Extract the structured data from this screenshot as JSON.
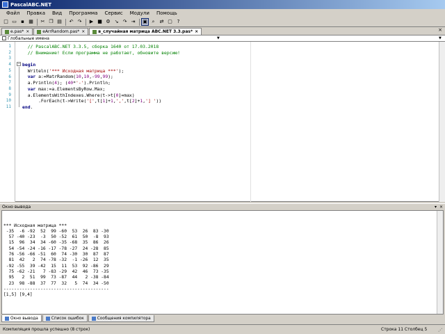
{
  "window": {
    "title": "PascalABC.NET"
  },
  "menu": [
    "Файл",
    "Правка",
    "Вид",
    "Программа",
    "Сервис",
    "Модули",
    "Помощь"
  ],
  "toolbar": {
    "buttons": [
      "new",
      "open",
      "save",
      "save-all",
      "cut",
      "copy",
      "paste",
      "undo",
      "redo",
      "run",
      "stop",
      "compile",
      "step-into",
      "step-over",
      "run-to-cursor",
      "toggle-output",
      "find",
      "replace",
      "form",
      "help"
    ],
    "active_index": 15
  },
  "tabs": [
    {
      "label": "e.pas*",
      "active": false
    },
    {
      "label": "eArrRandom.pas*",
      "active": false
    },
    {
      "label": "в_случайная матрица ABC.NET 3.3.pas*",
      "active": true
    }
  ],
  "navbar": {
    "scope": "Глобальные имена"
  },
  "editor": {
    "lines": [
      {
        "n": "1",
        "segments": [
          {
            "t": "  // PascalABC.NET 3.3.5, сборка 1640 от 17.03.2018",
            "c": "comment"
          }
        ]
      },
      {
        "n": "2",
        "segments": [
          {
            "t": "  // Внимание! Если программа не работает, обновите версию!",
            "c": "comment"
          }
        ]
      },
      {
        "n": "3",
        "segments": []
      },
      {
        "n": "4",
        "segments": [
          {
            "t": "begin",
            "c": "kw"
          }
        ]
      },
      {
        "n": "5",
        "segments": [
          {
            "t": "  Writeln(",
            "c": ""
          },
          {
            "t": "'*** Исходная матрица ***'",
            "c": "str"
          },
          {
            "t": ");",
            "c": ""
          }
        ]
      },
      {
        "n": "6",
        "segments": [
          {
            "t": "  ",
            "c": ""
          },
          {
            "t": "var",
            "c": "kw"
          },
          {
            "t": " a:=MatrRandom(",
            "c": ""
          },
          {
            "t": "10",
            "c": "num"
          },
          {
            "t": ",",
            "c": ""
          },
          {
            "t": "10",
            "c": "num"
          },
          {
            "t": ",-",
            "c": ""
          },
          {
            "t": "99",
            "c": "num"
          },
          {
            "t": ",",
            "c": ""
          },
          {
            "t": "99",
            "c": "num"
          },
          {
            "t": ");",
            "c": ""
          }
        ]
      },
      {
        "n": "7",
        "segments": [
          {
            "t": "  a.Println(",
            "c": ""
          },
          {
            "t": "4",
            "c": "num"
          },
          {
            "t": "); (",
            "c": ""
          },
          {
            "t": "40",
            "c": "num"
          },
          {
            "t": "*",
            "c": ""
          },
          {
            "t": "'-'",
            "c": "str"
          },
          {
            "t": ").Println;",
            "c": ""
          }
        ]
      },
      {
        "n": "8",
        "segments": [
          {
            "t": "  ",
            "c": ""
          },
          {
            "t": "var",
            "c": "kw"
          },
          {
            "t": " max:=a.ElementsByRow.Max;",
            "c": ""
          }
        ]
      },
      {
        "n": "9",
        "segments": [
          {
            "t": "  a.ElementsWithIndexes.Where(t->t[",
            "c": ""
          },
          {
            "t": "0",
            "c": "num"
          },
          {
            "t": "]=max)",
            "c": ""
          }
        ]
      },
      {
        "n": "10",
        "segments": [
          {
            "t": "      .ForEach(t->Write(",
            "c": ""
          },
          {
            "t": "'['",
            "c": "str"
          },
          {
            "t": ",t[",
            "c": ""
          },
          {
            "t": "1",
            "c": "num"
          },
          {
            "t": "]+",
            "c": ""
          },
          {
            "t": "1",
            "c": "num"
          },
          {
            "t": ",",
            "c": ""
          },
          {
            "t": "','",
            "c": "str"
          },
          {
            "t": ",t[",
            "c": ""
          },
          {
            "t": "2",
            "c": "num"
          },
          {
            "t": "]+",
            "c": ""
          },
          {
            "t": "1",
            "c": "num"
          },
          {
            "t": ",",
            "c": ""
          },
          {
            "t": "'] '",
            "c": "str"
          },
          {
            "t": "))",
            "c": ""
          }
        ]
      },
      {
        "n": "11",
        "segments": [
          {
            "t": "end",
            "c": "kw"
          },
          {
            "t": ".",
            "c": ""
          }
        ]
      }
    ]
  },
  "output": {
    "title": "Окно вывода",
    "lines": [
      "*** Исходная матрица ***",
      " -35  -6 -92  52  99 -60  53  26  83 -30",
      "  57 -40 -23  -3  50 -52  61  50  -8  93",
      "  15  96  34  34 -60 -35 -68  35  86  26",
      "  54 -54 -24 -16 -17 -78 -27  24 -28  85",
      "  76 -56 -66 -51  60  74 -30  30  87  87",
      "  81  42   2  74 -78 -32  -1 -26  12  35",
      " -92 -55  39 -42  15  11  53  92 -86  29",
      "  75 -62 -21   7 -83 -29  42  46  73 -35",
      "  95   2  51  99  73 -87  44   2 -38 -84",
      "  23  98 -88  37  77  32   5  74  34 -50",
      "----------------------------------------",
      "[1,5] [9,4]"
    ]
  },
  "bottom_tabs": [
    {
      "label": "Окно вывода",
      "active": true
    },
    {
      "label": "Список ошибок",
      "active": false
    },
    {
      "label": "Сообщения компилятора",
      "active": false
    }
  ],
  "status": {
    "message": "Компиляция прошла успешно (8 строк)",
    "position": "Строка  11  Столбец  5"
  }
}
